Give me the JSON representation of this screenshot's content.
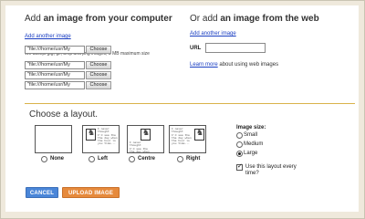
{
  "left_panel": {
    "title_prefix": "Add ",
    "title_strong": "an image from your computer",
    "add_another": "Add another image",
    "note": "We accept jpg, gif, bmp and png images, 3 MB maximum size",
    "files": [
      {
        "value": "\"file:///home/usr/My",
        "button": "Choose"
      },
      {
        "value": "\"file:///home/usr/My",
        "button": "Choose"
      },
      {
        "value": "\"file:///home/usr/My",
        "button": "Choose"
      },
      {
        "value": "\"file:///home/usr/My",
        "button": "Choose"
      }
    ]
  },
  "right_panel": {
    "title_prefix": "Or add ",
    "title_strong": "an image from the web",
    "add_another": "Add another image",
    "url_label": "URL",
    "url_value": "",
    "learn_link": "Learn more",
    "learn_text": " about using web images"
  },
  "layout": {
    "title": "Choose a layout.",
    "options": [
      {
        "label": "None",
        "selected": false
      },
      {
        "label": "Left",
        "selected": false
      },
      {
        "label": "Centre",
        "selected": false
      },
      {
        "label": "Right",
        "selected": false
      }
    ],
    "sample_text": "I never\nthought\nI'd see the\nthe day when\nthe hour is\nyou time..."
  },
  "image_size": {
    "title": "Image size:",
    "options": [
      {
        "label": "Small",
        "selected": false
      },
      {
        "label": "Medium",
        "selected": false
      },
      {
        "label": "Large",
        "selected": true
      }
    ]
  },
  "remember": {
    "label": "Use this layout every time?",
    "checked": true
  },
  "actions": {
    "cancel": "CANCEL",
    "upload": "UPLOAD IMAGE"
  }
}
